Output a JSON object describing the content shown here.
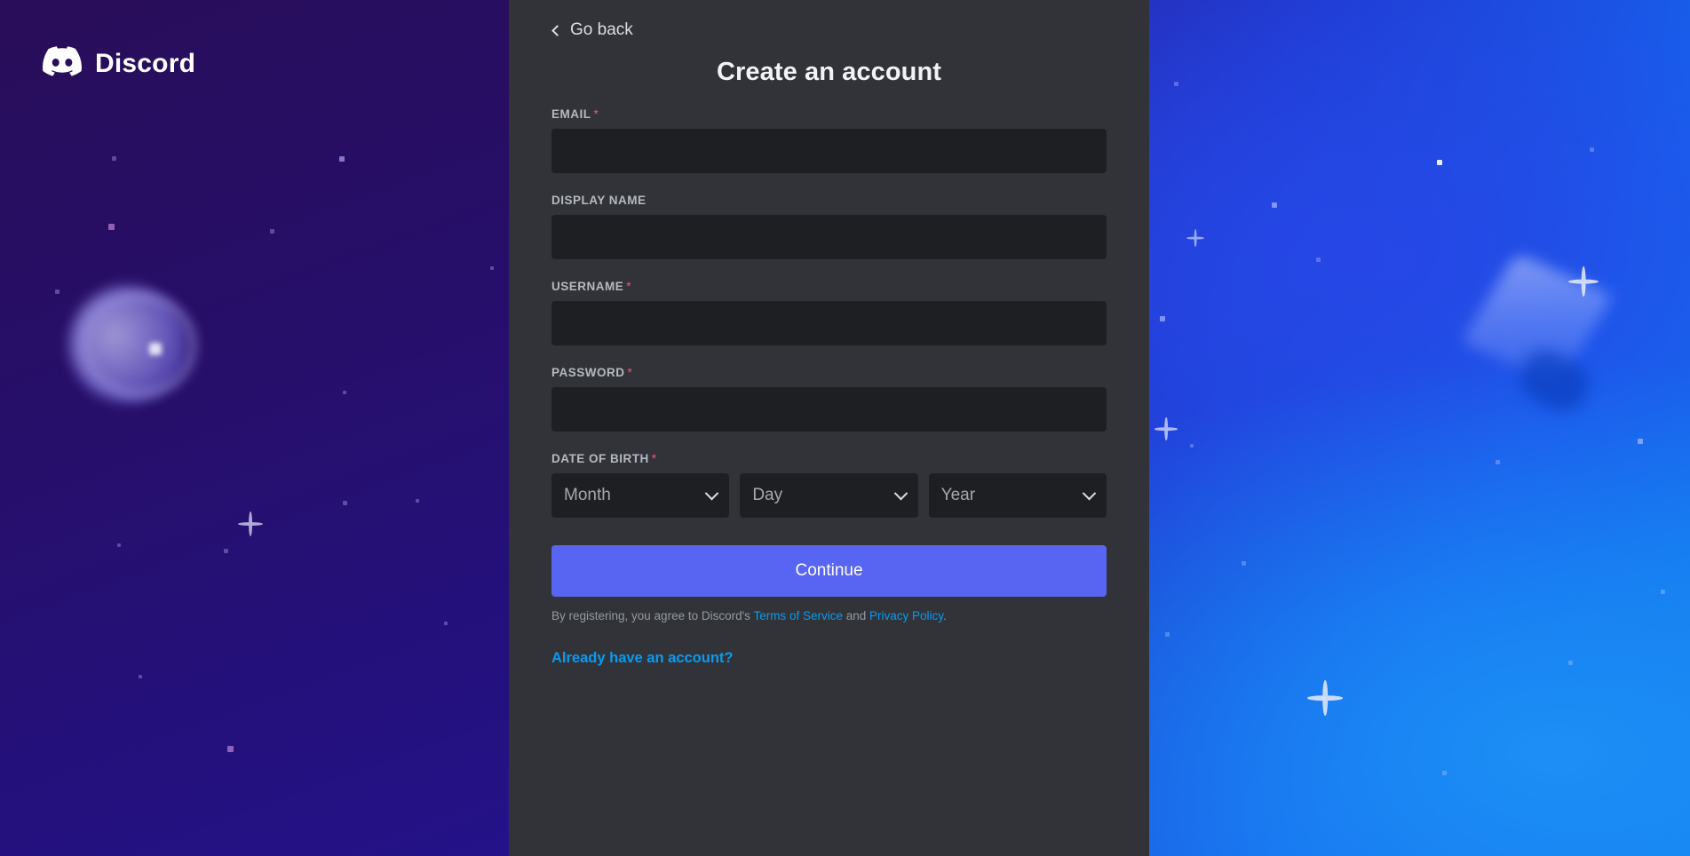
{
  "brand": {
    "name": "Discord",
    "logo_icon": "discord-clyde-icon",
    "blurple": "#5865f2"
  },
  "panel": {
    "go_back": "Go back",
    "go_back_icon": "chevron-left-icon",
    "title": "Create an account"
  },
  "form": {
    "fields": [
      {
        "label": "EMAIL",
        "required": true,
        "value": "",
        "placeholder": ""
      },
      {
        "label": "DISPLAY NAME",
        "required": false,
        "value": "",
        "placeholder": ""
      },
      {
        "label": "USERNAME",
        "required": true,
        "value": "",
        "placeholder": ""
      },
      {
        "label": "PASSWORD",
        "required": true,
        "value": "",
        "placeholder": ""
      }
    ],
    "required_marker": "*",
    "dob": {
      "label": "DATE OF BIRTH",
      "required": true,
      "selects": [
        {
          "name": "month",
          "value": "Month",
          "icon": "chevron-down-icon"
        },
        {
          "name": "day",
          "value": "Day",
          "icon": "chevron-down-icon"
        },
        {
          "name": "year",
          "value": "Year",
          "icon": "chevron-down-icon"
        }
      ]
    },
    "submit_label": "Continue"
  },
  "legal": {
    "prefix": "By registering, you agree to Discord's ",
    "terms_link": "Terms of Service",
    "conjunction": " and ",
    "privacy_link": "Privacy Policy",
    "suffix": "."
  },
  "login_link": "Already have an account?",
  "colors": {
    "panel_bg": "#313338",
    "input_bg": "#1e1f22",
    "label": "#b5bac1",
    "required_asterisk": "#f6566a",
    "link": "#0a9bf1",
    "accent": "#5865f2"
  }
}
